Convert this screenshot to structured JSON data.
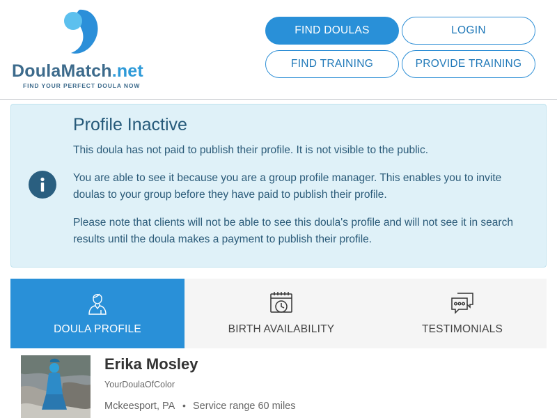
{
  "header": {
    "logo": {
      "name": "DoulaMatch",
      "tld": ".net",
      "tagline": "FIND YOUR PERFECT DOULA NOW"
    },
    "nav": {
      "find_doulas": "FIND DOULAS",
      "login": "LOGIN",
      "find_training": "FIND TRAINING",
      "provide_training": "PROVIDE TRAINING"
    }
  },
  "alert": {
    "icon": "info-icon",
    "title": "Profile Inactive",
    "p1": "This doula has not paid to publish their profile. It is not visible to the public.",
    "p2": "You are able to see it because you are a group profile manager. This enables you to invite doulas to your group before they have paid to publish their profile.",
    "p3": "Please note that clients will not be able to see this doula's profile and will not see it in search results until the doula makes a payment to publish their profile."
  },
  "tabs": [
    {
      "label": "DOULA PROFILE",
      "icon": "doula-person-icon",
      "active": true
    },
    {
      "label": "BIRTH AVAILABILITY",
      "icon": "calendar-clock-icon",
      "active": false
    },
    {
      "label": "TESTIMONIALS",
      "icon": "chat-bubbles-icon",
      "active": false
    }
  ],
  "profile": {
    "name": "Erika Mosley",
    "business": "YourDoulaOfColor",
    "location": "Mckeesport, PA",
    "separator": "•",
    "service_range": "Service range 60 miles"
  },
  "colors": {
    "brand_blue": "#2990d8",
    "logo_navy": "#3d6b8c",
    "alert_bg": "#dff1f8",
    "alert_text": "#2a5a78"
  }
}
